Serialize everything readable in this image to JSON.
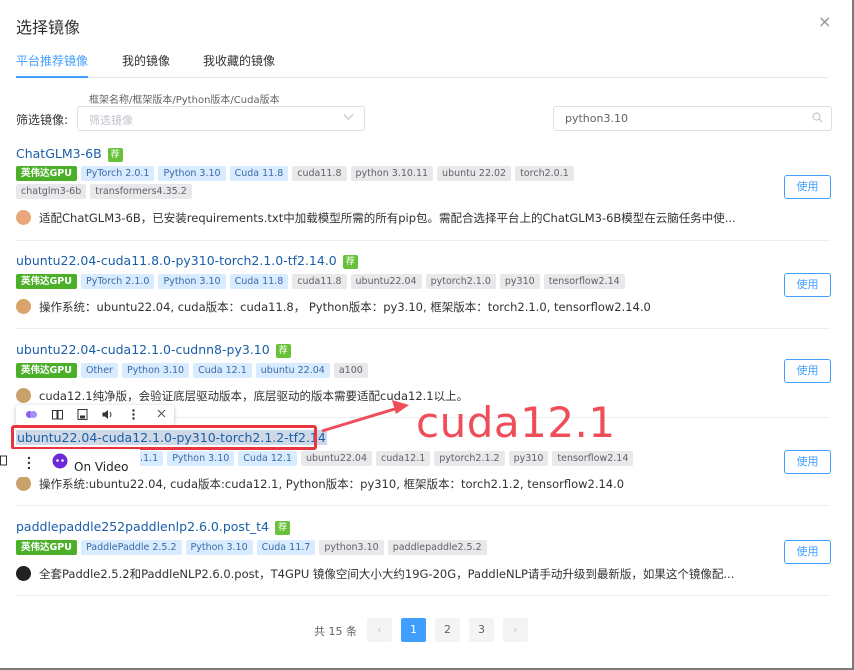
{
  "dialog": {
    "title": "选择镜像",
    "close_icon": "×"
  },
  "tabs": [
    {
      "label": "平台推荐镜像",
      "active": true
    },
    {
      "label": "我的镜像",
      "active": false
    },
    {
      "label": "我收藏的镜像",
      "active": false
    }
  ],
  "filter": {
    "hint": "框架名称/框架版本/Python版本/Cuda版本",
    "label": "筛选镜像:",
    "placeholder": "筛选镜像",
    "search_value": "python3.10"
  },
  "cards": [
    {
      "title": "ChatGLM3-6B",
      "rec": "荐",
      "tags": [
        {
          "text": "英伟达GPU",
          "kind": "gpu"
        },
        {
          "text": "PyTorch 2.0.1",
          "kind": "fw"
        },
        {
          "text": "Python 3.10",
          "kind": "fw"
        },
        {
          "text": "Cuda 11.8",
          "kind": "fw"
        },
        {
          "text": "cuda11.8",
          "kind": "plain"
        },
        {
          "text": "python 3.10.11",
          "kind": "plain"
        },
        {
          "text": "ubuntu 22.02",
          "kind": "plain"
        },
        {
          "text": "torch2.0.1",
          "kind": "plain"
        },
        {
          "text": "chatglm3-6b",
          "kind": "plain"
        },
        {
          "text": "transformers4.35.2",
          "kind": "plain"
        }
      ],
      "desc": "适配ChatGLM3-6B，已安装requirements.txt中加载模型所需的所有pip包。需配合选择平台上的ChatGLM3-6B模型在云脑任务中使...",
      "button": "使用"
    },
    {
      "title": "ubuntu22.04-cuda11.8.0-py310-torch2.1.0-tf2.14.0",
      "rec": "荐",
      "tags": [
        {
          "text": "英伟达GPU",
          "kind": "gpu"
        },
        {
          "text": "PyTorch 2.1.0",
          "kind": "fw"
        },
        {
          "text": "Python 3.10",
          "kind": "fw"
        },
        {
          "text": "Cuda 11.8",
          "kind": "fw"
        },
        {
          "text": "cuda11.8",
          "kind": "plain"
        },
        {
          "text": "ubuntu22.04",
          "kind": "plain"
        },
        {
          "text": "pytorch2.1.0",
          "kind": "plain"
        },
        {
          "text": "py310",
          "kind": "plain"
        },
        {
          "text": "tensorflow2.14",
          "kind": "plain"
        }
      ],
      "desc": "操作系统：ubuntu22.04, cuda版本：cuda11.8， Python版本：py3.10, 框架版本：torch2.1.0, tensorflow2.14.0",
      "button": "使用"
    },
    {
      "title": "ubuntu22.04-cuda12.1.0-cudnn8-py3.10",
      "rec": "荐",
      "tags": [
        {
          "text": "英伟达GPU",
          "kind": "gpu"
        },
        {
          "text": "Other",
          "kind": "fw"
        },
        {
          "text": "Python 3.10",
          "kind": "fw"
        },
        {
          "text": "Cuda 12.1",
          "kind": "fw"
        },
        {
          "text": "ubuntu 22.04",
          "kind": "fw"
        },
        {
          "text": "a100",
          "kind": "plain"
        }
      ],
      "desc": "cuda12.1纯净版，会验证底层驱动版本，底层驱动的版本需要适配cuda12.1以上。",
      "button": "使用"
    },
    {
      "title": "ubuntu22.04-cuda12.1.0-py310-torch2.1.2-tf2.14",
      "rec": "荐",
      "tags": [
        {
          "text": "2.1.1",
          "kind": "fw"
        },
        {
          "text": "Python 3.10",
          "kind": "fw"
        },
        {
          "text": "Cuda 12.1",
          "kind": "fw"
        },
        {
          "text": "ubuntu22.04",
          "kind": "plain"
        },
        {
          "text": "cuda12.1",
          "kind": "plain"
        },
        {
          "text": "pytorch2.1.2",
          "kind": "plain"
        },
        {
          "text": "py310",
          "kind": "plain"
        },
        {
          "text": "tensorflow2.14",
          "kind": "plain"
        }
      ],
      "desc": "操作系统:ubuntu22.04, cuda版本:cuda12.1, Python版本：py310, 框架版本：torch2.1.2, tensorflow2.14.0",
      "button": "使用"
    },
    {
      "title": "paddlepaddle252paddlenlp2.6.0.post_t4",
      "rec": "荐",
      "tags": [
        {
          "text": "英伟达GPU",
          "kind": "gpu"
        },
        {
          "text": "PaddlePaddle 2.5.2",
          "kind": "fw"
        },
        {
          "text": "Python 3.10",
          "kind": "fw"
        },
        {
          "text": "Cuda 11.7",
          "kind": "fw"
        },
        {
          "text": "python3.10",
          "kind": "plain"
        },
        {
          "text": "paddlepaddle2.5.2",
          "kind": "plain"
        }
      ],
      "desc": "全套Paddle2.5.2和PaddleNLP2.6.0.post，T4GPU 镜像空间大小大约19G-20G，PaddleNLP请手动升级到最新版，如果这个镜像配...",
      "button": "使用"
    }
  ],
  "pagination": {
    "total": "共 15 条",
    "pages": [
      "1",
      "2",
      "3"
    ],
    "current": "1",
    "prev": "‹",
    "next": "›"
  },
  "overlay": {
    "popup_label": "On Video",
    "annotation": "cuda12.1",
    "annotation_color": "#ee4d59"
  },
  "colors": {
    "primary": "#409eff",
    "gpu_tag": "#4caf2a",
    "link": "#1a5ea8"
  }
}
